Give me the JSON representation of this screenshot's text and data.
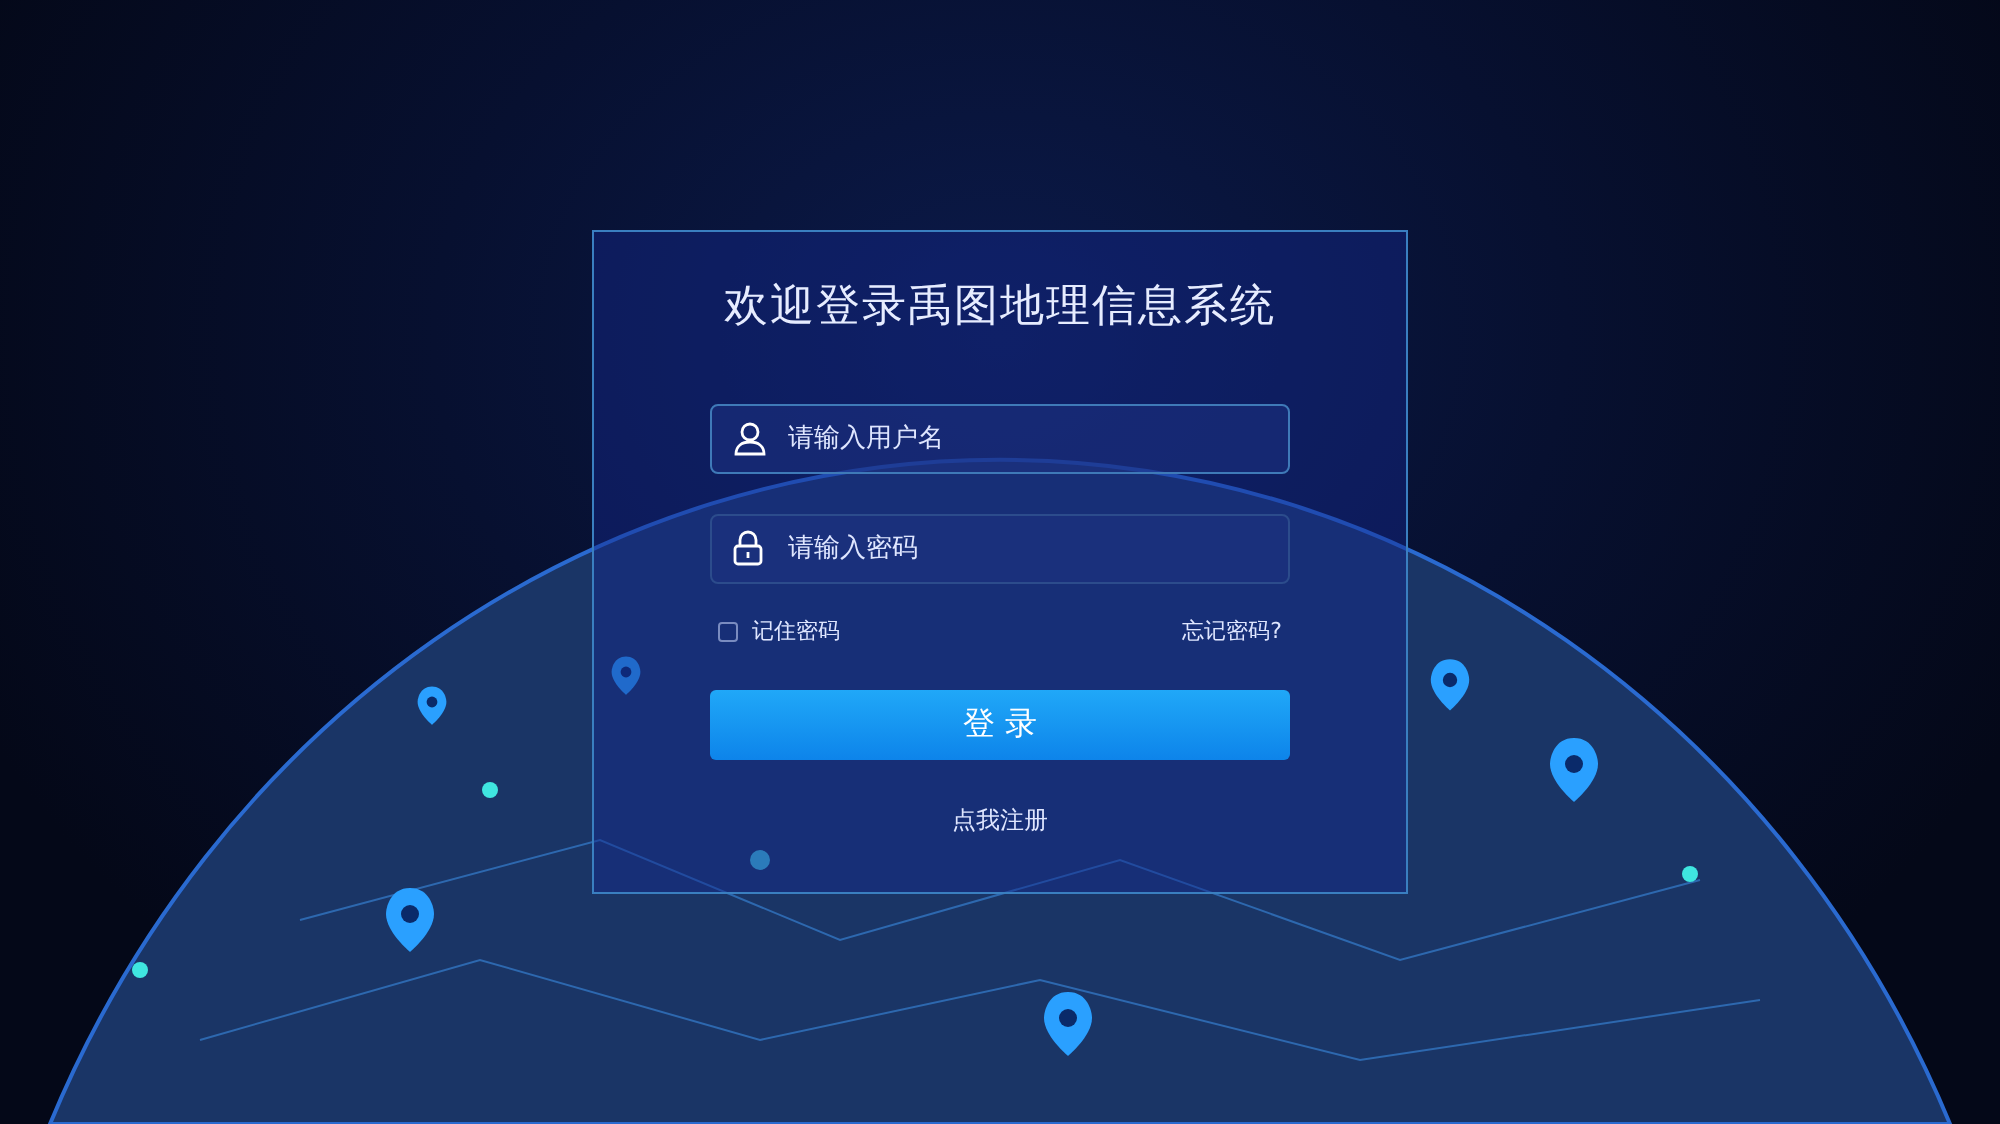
{
  "title": "欢迎登录禹图地理信息系统",
  "fields": [
    {
      "kind": "user",
      "placeholder": "请输入用户名"
    },
    {
      "kind": "password",
      "placeholder": "请输入密码"
    }
  ],
  "remember": {
    "label": "记住密码",
    "checked": false
  },
  "forgot": "忘记密码?",
  "submit": "登 录",
  "register": "点我注册"
}
